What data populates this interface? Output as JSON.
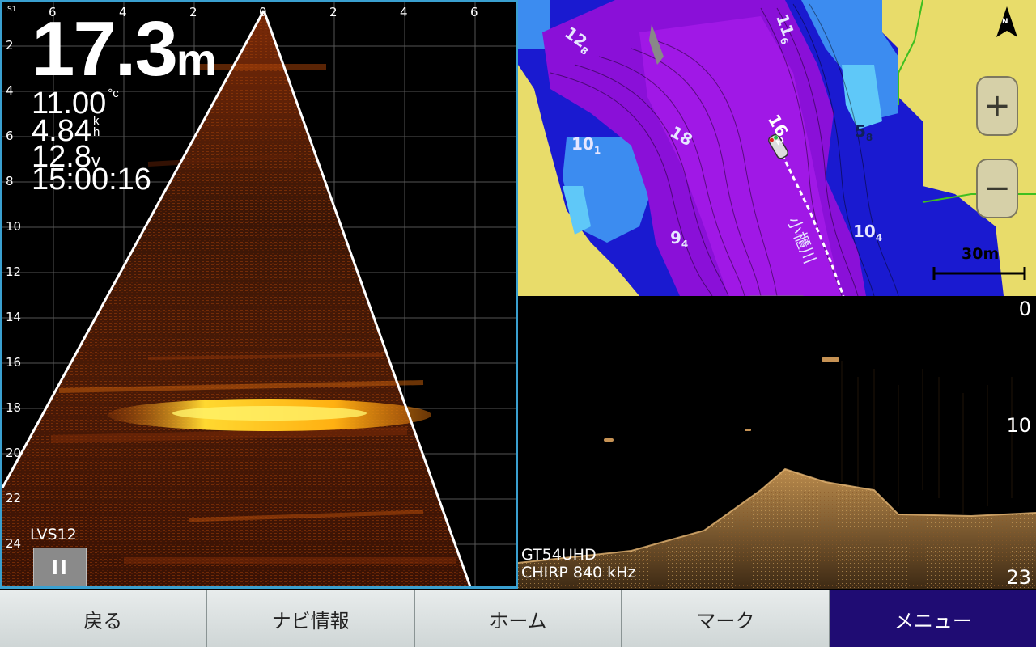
{
  "livescope": {
    "corner_label": "S1",
    "x_ticks": [
      "6",
      "4",
      "2",
      "0",
      "2",
      "4",
      "6"
    ],
    "y_ticks": [
      "2",
      "4",
      "6",
      "8",
      "10",
      "12",
      "14",
      "16",
      "18",
      "20",
      "22",
      "24"
    ],
    "depth_value": "17.3",
    "depth_unit": "m",
    "temperature": "11.00",
    "temperature_unit": "°c",
    "speed": "4.84",
    "speed_unit_top": "k",
    "speed_unit_bottom": "h",
    "voltage": "12.8",
    "voltage_unit": "v",
    "time": "15:00:16",
    "mode": "LVS12",
    "pause_symbol": "II"
  },
  "map": {
    "depth_labels": [
      {
        "main": "12",
        "sub": "8"
      },
      {
        "main": "11",
        "sub": "6"
      },
      {
        "main": "16",
        "sub": "2"
      },
      {
        "main": "18",
        "sub": ""
      },
      {
        "main": "10",
        "sub": "1"
      },
      {
        "main": "5",
        "sub": "8"
      },
      {
        "main": "9",
        "sub": "4"
      },
      {
        "main": "10",
        "sub": "4"
      }
    ],
    "river_name": "小櫃川",
    "scale": "30m",
    "zoom_in": "+",
    "zoom_out": "−",
    "north_label": "N",
    "collapse_icon": "chevron-double-down"
  },
  "sonar": {
    "depth_top": "0",
    "depth_mid": "10",
    "depth_bottom": "23",
    "transducer": "GT54UHD",
    "frequency": "CHIRP 840 kHz"
  },
  "bottom_bar": {
    "back": "戻る",
    "nav_info": "ナビ情報",
    "home": "ホーム",
    "mark": "マーク",
    "menu": "メニュー"
  },
  "colors": {
    "accent_active": "#1f0c73",
    "panel_border": "#3aa0d0",
    "land": "#e8dc6a"
  }
}
